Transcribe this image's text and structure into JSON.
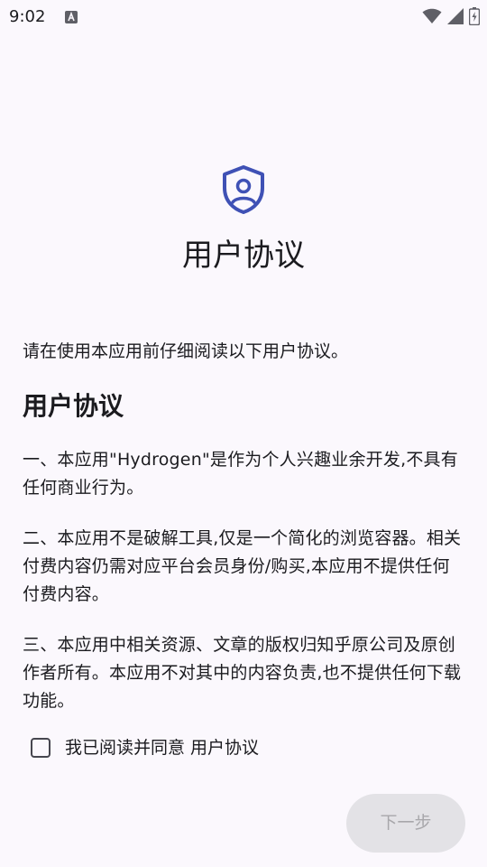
{
  "status_bar": {
    "time": "9:02",
    "icons": [
      "a-icon",
      "wifi-icon",
      "signal-icon",
      "battery-icon"
    ]
  },
  "colors": {
    "background": "#fbf8fd",
    "accent": "#3f51b5",
    "text": "#1b1b1f",
    "button_disabled_bg": "#e3e2e6",
    "button_disabled_text": "#a8a7ab"
  },
  "header": {
    "icon": "shield-user-icon",
    "title": "用户协议"
  },
  "content": {
    "intro": "请在使用本应用前仔细阅读以下用户协议。",
    "heading": "用户协议",
    "paragraphs": [
      "一、本应用\"Hydrogen\"是作为个人兴趣业余开发,不具有任何商业行为。",
      "二、本应用不是破解工具,仅是一个简化的浏览容器。相关付费内容仍需对应平台会员身份/购买,本应用不提供任何付费内容。",
      "三、本应用中相关资源、文章的版权归知乎原公司及原创作者所有。本应用不对其中的内容负责,也不提供任何下载功能。"
    ]
  },
  "agreement": {
    "checked": false,
    "label": "我已阅读并同意 用户协议"
  },
  "footer": {
    "next_label": "下一步",
    "next_enabled": false
  }
}
